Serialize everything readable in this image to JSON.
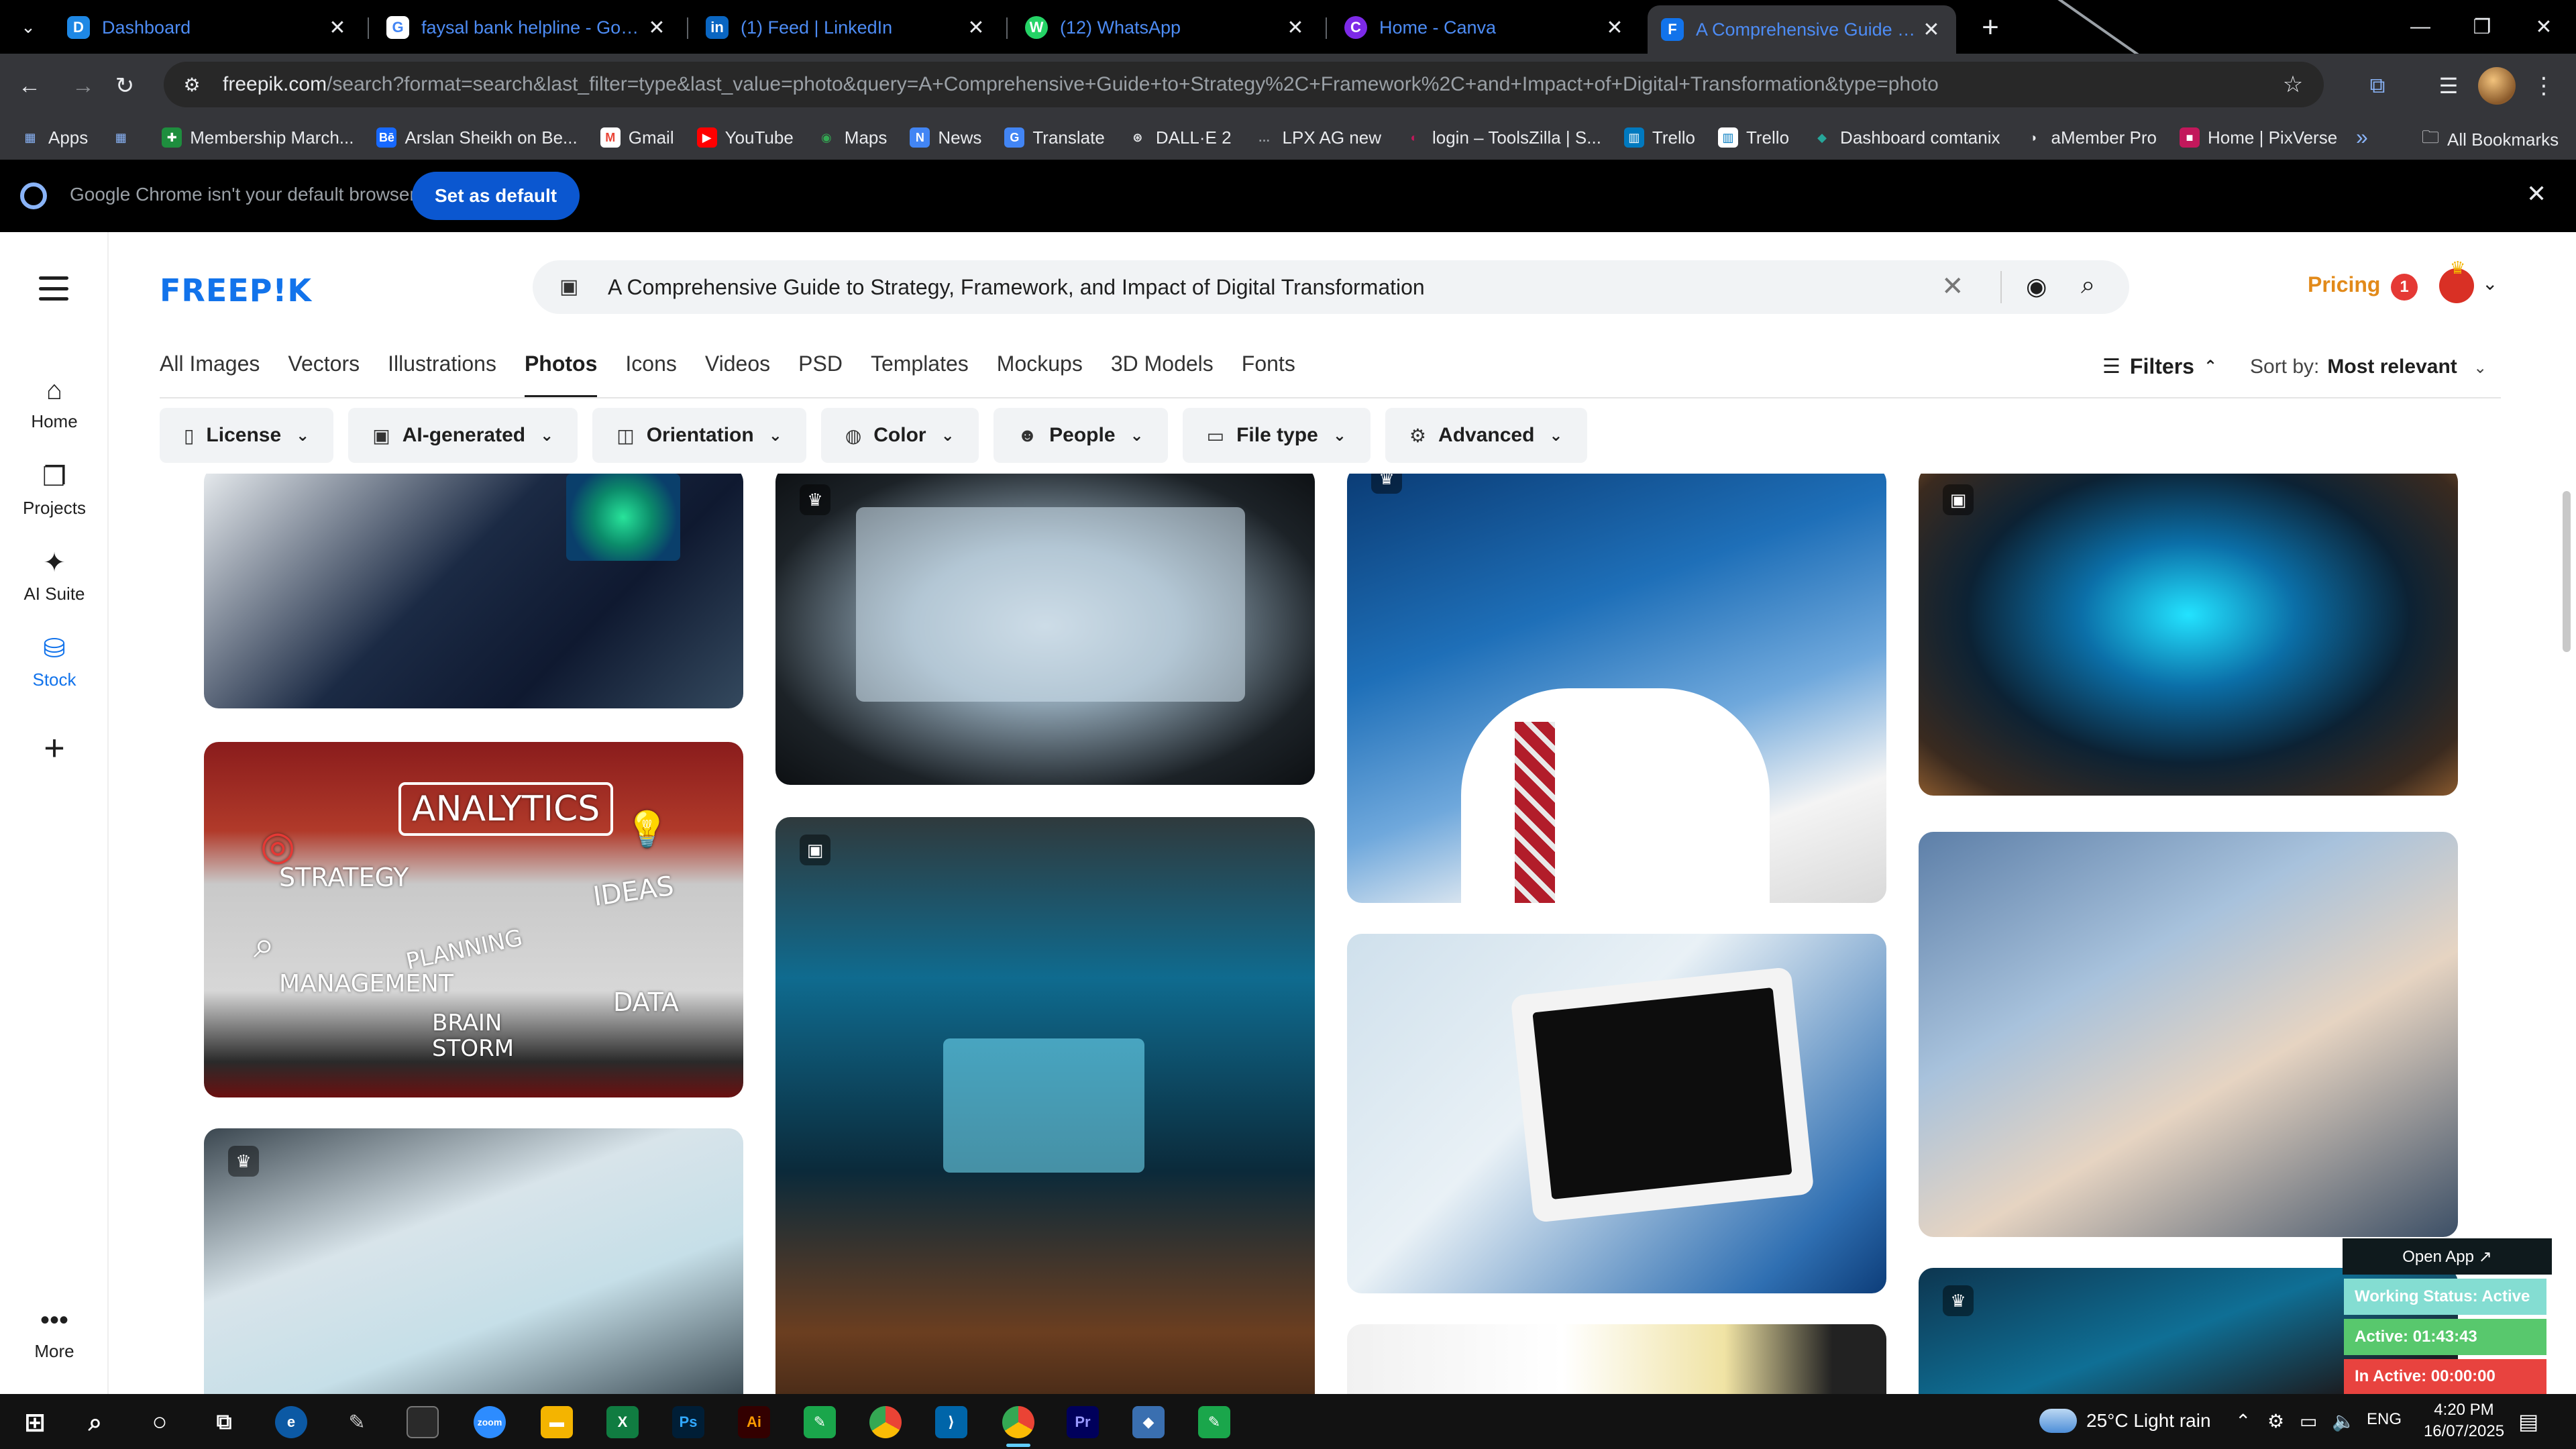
{
  "browser": {
    "tabs": [
      {
        "title": "Dashboard",
        "favicon": "D"
      },
      {
        "title": "faysal bank helpline - Google S",
        "favicon": "G"
      },
      {
        "title": "(1) Feed | LinkedIn",
        "favicon": "in"
      },
      {
        "title": "(12) WhatsApp",
        "favicon": "W"
      },
      {
        "title": "Home - Canva",
        "favicon": "C"
      },
      {
        "title": "A Comprehensive Guide to Stra",
        "favicon": "F"
      }
    ],
    "url_host": "freepik.com",
    "url_path": "/search?format=search&last_filter=type&last_value=photo&query=A+Comprehensive+Guide+to+Strategy%2C+Framework%2C+and+Impact+of+Digital+Transformation&type=photo",
    "bookmarks": [
      {
        "label": "Apps",
        "icon": "▦"
      },
      {
        "label": "",
        "icon": "▦"
      },
      {
        "label": "Membership March...",
        "icon": "✚"
      },
      {
        "label": "Arslan Sheikh on Be...",
        "icon": "Bē"
      },
      {
        "label": "Gmail",
        "icon": "M"
      },
      {
        "label": "YouTube",
        "icon": "▶"
      },
      {
        "label": "Maps",
        "icon": "◉"
      },
      {
        "label": "News",
        "icon": "N"
      },
      {
        "label": "Translate",
        "icon": "G"
      },
      {
        "label": "DALL·E 2",
        "icon": "⊛"
      },
      {
        "label": "LPX AG new",
        "icon": "…"
      },
      {
        "label": "login – ToolsZilla | S...",
        "icon": "◐"
      },
      {
        "label": "Trello",
        "icon": "▥"
      },
      {
        "label": "Trello",
        "icon": "▥"
      },
      {
        "label": "Dashboard comtanix",
        "icon": "◆"
      },
      {
        "label": "aMember Pro",
        "icon": "◑"
      },
      {
        "label": "Home | PixVerse",
        "icon": "■"
      }
    ],
    "bookmarks_more": "»",
    "all_bookmarks": "All Bookmarks",
    "infobar_text": "Google Chrome isn't your default browser",
    "infobar_button": "Set as default"
  },
  "freepik": {
    "logo": "FREEP!K",
    "rail": [
      {
        "label": "Home",
        "icon": "⌂"
      },
      {
        "label": "Projects",
        "icon": "❐"
      },
      {
        "label": "AI Suite",
        "icon": "✦"
      },
      {
        "label": "Stock",
        "icon": "⛁"
      }
    ],
    "rail_more": "More",
    "search_query": "A Comprehensive Guide to Strategy, Framework, and Impact of Digital Transformation",
    "pricing": "Pricing",
    "notification_count": "1",
    "type_tabs": [
      "All Images",
      "Vectors",
      "Illustrations",
      "Photos",
      "Icons",
      "Videos",
      "PSD",
      "Templates",
      "Mockups",
      "3D Models",
      "Fonts"
    ],
    "active_tab": "Photos",
    "filters_label": "Filters",
    "sort_label": "Sort by:",
    "sort_value": "Most relevant",
    "filter_chips": [
      {
        "label": "License",
        "icon": "▯"
      },
      {
        "label": "AI-generated",
        "icon": "▣"
      },
      {
        "label": "Orientation",
        "icon": "◫"
      },
      {
        "label": "Color",
        "icon": "◍"
      },
      {
        "label": "People",
        "icon": "☻"
      },
      {
        "label": "File type",
        "icon": "▭"
      },
      {
        "label": "Advanced",
        "icon": "⚙"
      }
    ],
    "tile5_words": {
      "analytics": "ANALYTICS",
      "strategy": "STRATEGY",
      "ideas": "IDEAS",
      "planning": "PLANNING",
      "management": "MANAGEMENT",
      "brainstorm": "BRAIN STORM",
      "data": "DATA"
    }
  },
  "status_widget": {
    "open_app": "Open App ↗",
    "working_status": "Working Status: Active",
    "active_time": "Active: 01:43:43",
    "inactive_time": "In Active: 00:00:00"
  },
  "taskbar": {
    "weather": "25°C  Light rain",
    "language": "ENG",
    "time": "4:20 PM",
    "date": "16/07/2025"
  },
  "colors": {
    "freepik_blue": "#1273eb",
    "pricing_orange": "#e28a1a",
    "chrome_dark": "#35363a"
  }
}
